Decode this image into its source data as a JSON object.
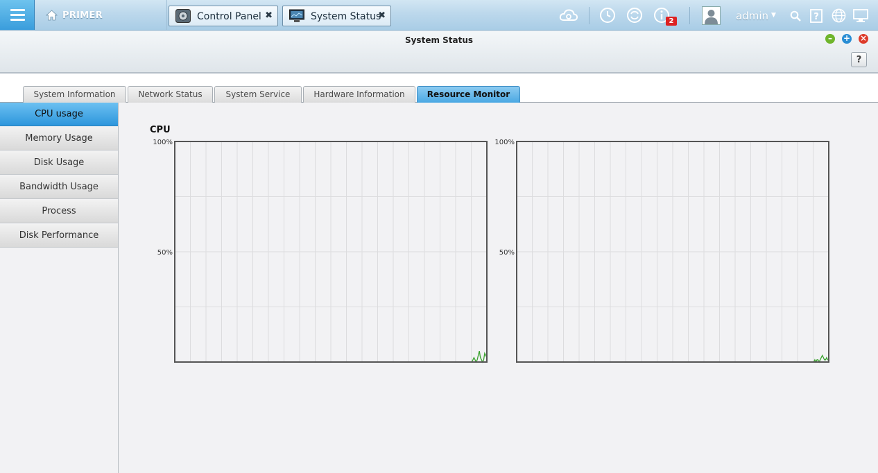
{
  "topbar": {
    "brand": "PRIMER",
    "tabs": [
      {
        "label": "Control Panel",
        "close": "✖"
      },
      {
        "label": "System Status",
        "close": "✖"
      }
    ],
    "notification_count": "2",
    "user": "admin",
    "user_caret": "▼"
  },
  "window": {
    "title": "System Status",
    "help": "?",
    "controls": {
      "minimize": "–",
      "maximize": "+",
      "close": "×"
    }
  },
  "tabs": [
    {
      "label": "System Information",
      "active": false
    },
    {
      "label": "Network Status",
      "active": false
    },
    {
      "label": "System Service",
      "active": false
    },
    {
      "label": "Hardware Information",
      "active": false
    },
    {
      "label": "Resource Monitor",
      "active": true
    }
  ],
  "sidebar": {
    "items": [
      {
        "label": "CPU usage",
        "active": true
      },
      {
        "label": "Memory Usage",
        "active": false
      },
      {
        "label": "Disk Usage",
        "active": false
      },
      {
        "label": "Bandwidth Usage",
        "active": false
      },
      {
        "label": "Process",
        "active": false
      },
      {
        "label": "Disk Performance",
        "active": false
      }
    ]
  },
  "section": {
    "title": "CPU"
  },
  "chart_data": [
    {
      "type": "line",
      "title": "",
      "ylim": [
        0,
        100
      ],
      "yticks": [
        "100%",
        "50%"
      ],
      "series": [
        {
          "values": [
            0,
            0,
            0,
            1,
            2,
            1,
            0,
            1,
            3,
            5,
            2,
            1,
            0,
            1,
            4,
            3,
            2
          ]
        }
      ],
      "color": "#3aa22e"
    },
    {
      "type": "line",
      "title": "",
      "ylim": [
        0,
        100
      ],
      "yticks": [
        "100%",
        "50%"
      ],
      "series": [
        {
          "values": [
            0,
            0,
            0,
            1,
            0,
            1,
            1,
            0,
            1,
            2,
            3,
            2,
            1,
            1,
            2,
            1,
            1
          ]
        }
      ],
      "color": "#3aa22e"
    }
  ],
  "colors": {
    "accent": "#3a9ddc",
    "badge": "#dd2222",
    "cpu_line": "#3aa22e"
  }
}
